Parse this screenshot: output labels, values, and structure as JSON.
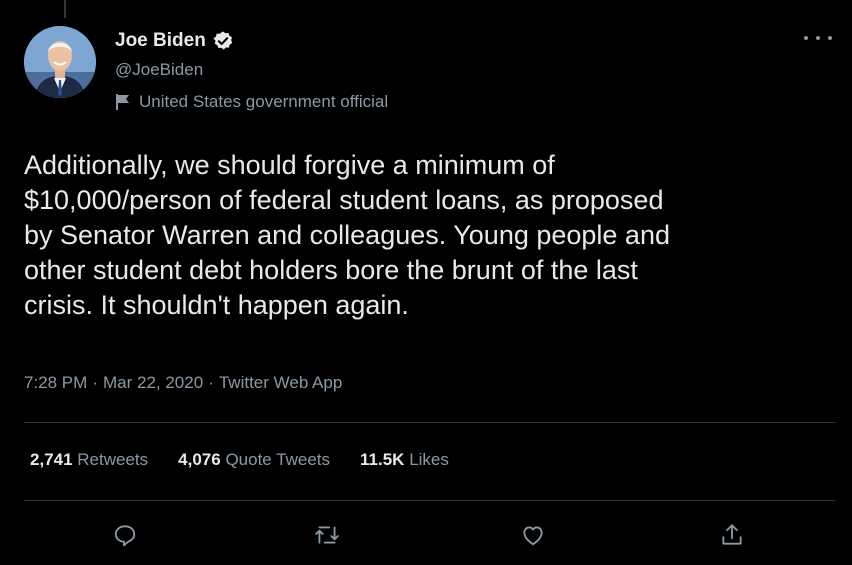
{
  "author": {
    "name": "Joe Biden",
    "handle": "@JoeBiden",
    "label": "United States government official"
  },
  "tweet": {
    "text": "Additionally, we should forgive a minimum of\n$10,000/person of federal student loans, as proposed\nby Senator Warren and colleagues. Young people and\nother student debt holders bore the brunt of the last\ncrisis. It shouldn't happen again.",
    "time": "7:28 PM",
    "date": "Mar 22, 2020",
    "source": "Twitter Web App",
    "separator": "·"
  },
  "stats": {
    "retweets_count": "2,741",
    "retweets_label": "Retweets",
    "quotes_count": "4,076",
    "quotes_label": "Quote Tweets",
    "likes_count": "11.5K",
    "likes_label": "Likes"
  },
  "icons": {
    "verified": "verified-badge-icon",
    "flag": "flag-icon",
    "more": "more-icon",
    "reply": "reply-icon",
    "retweet": "retweet-icon",
    "like": "heart-icon",
    "share": "share-icon"
  },
  "colors": {
    "background": "#000000",
    "text_primary": "#e7e9ea",
    "text_secondary": "#8b98a5",
    "divider": "#2f3336"
  }
}
